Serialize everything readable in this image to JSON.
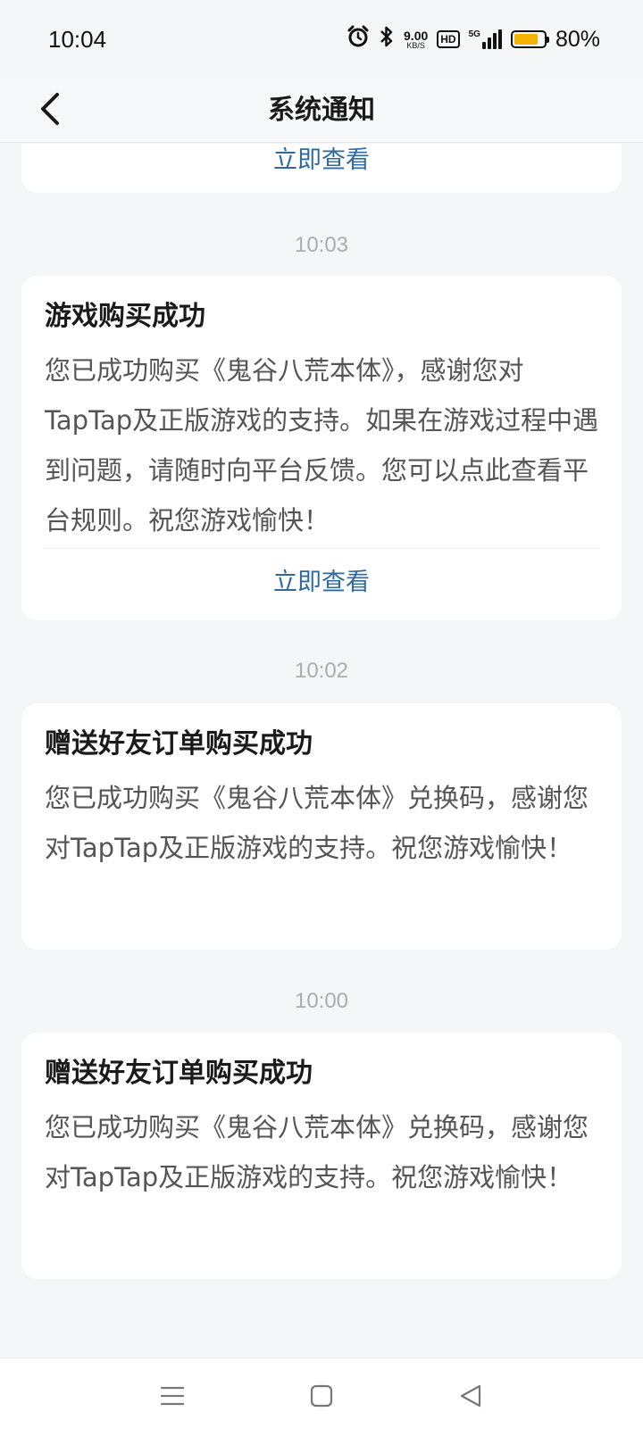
{
  "status_bar": {
    "time": "10:04",
    "net_speed_value": "9.00",
    "net_speed_unit": "KB/S",
    "hd_label": "HD",
    "network_type": "5G",
    "battery_percent_text": "80%",
    "battery_level": 0.8,
    "icons": [
      "alarm-icon",
      "bluetooth-icon",
      "signal-icon",
      "battery-icon"
    ]
  },
  "header": {
    "title": "系统通知",
    "back_icon": "chevron-left-icon"
  },
  "notifications": [
    {
      "action_label": "立即查看"
    },
    {
      "time": "10:03",
      "title": "游戏购买成功",
      "body": "您已成功购买《鬼谷八荒本体》，感谢您对TapTap及正版游戏的支持。如果在游戏过程中遇到问题，请随时向平台反馈。您可以点此查看平台规则。祝您游戏愉快！",
      "action_label": "立即查看"
    },
    {
      "time": "10:02",
      "title": "赠送好友订单购买成功",
      "body": "您已成功购买《鬼谷八荒本体》兑换码，感谢您对TapTap及正版游戏的支持。祝您游戏愉快！"
    },
    {
      "time": "10:00",
      "title": "赠送好友订单购买成功",
      "body": "您已成功购买《鬼谷八荒本体》兑换码，感谢您对TapTap及正版游戏的支持。祝您游戏愉快！"
    }
  ],
  "system_nav": {
    "icons": [
      "menu-icon",
      "home-icon",
      "back-triangle-icon"
    ]
  },
  "colors": {
    "background": "#f4f6f8",
    "card": "#ffffff",
    "link": "#2e6a9e",
    "battery": "#f5b301",
    "timestamp": "#a8adb3"
  }
}
